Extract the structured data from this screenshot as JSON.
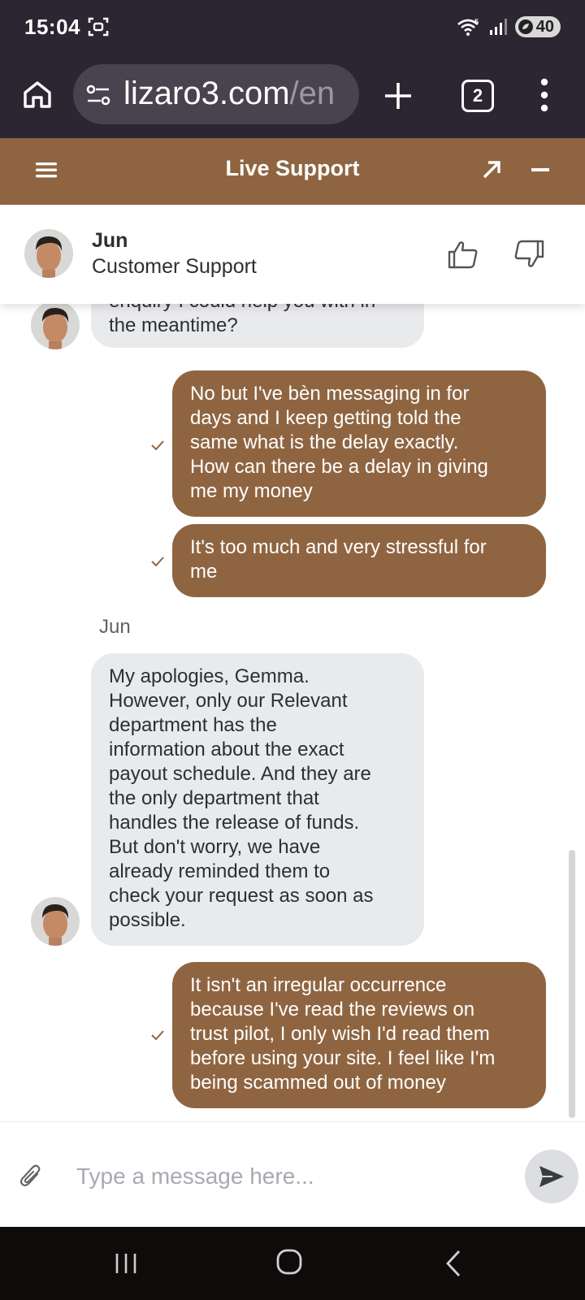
{
  "status_bar": {
    "time": "15:04",
    "battery": "40",
    "icons": [
      "screenshot-icon",
      "wifi-icon",
      "signal-icon",
      "battery-icon"
    ]
  },
  "browser": {
    "url_domain": "lizaro3.com",
    "url_path": "/en",
    "tab_count": "2",
    "icons": [
      "home-icon",
      "site-settings-icon",
      "plus-icon",
      "more-vert-icon"
    ]
  },
  "support_header": {
    "title": "Live Support",
    "icons": [
      "hamburger-icon",
      "expand-icon",
      "minimize-icon"
    ]
  },
  "agent": {
    "name": "Jun",
    "role": "Customer Support"
  },
  "messages": [
    {
      "from": "agent",
      "text": "enquiry I could help you with in\nthe meantime?"
    },
    {
      "from": "user",
      "text": "No but I've bèn messaging in for\ndays and I keep getting told the\nsame what is the delay exactly.\nHow can there be a delay in giving\nme my money"
    },
    {
      "from": "user",
      "text": "It's too much and very stressful for\nme"
    },
    {
      "from": "agent",
      "sender": "Jun",
      "text": "My apologies, Gemma.\nHowever, only our Relevant\ndepartment has the\ninformation about the exact\npayout schedule. And they are\nthe only department that\nhandles the release of funds.\nBut don't worry, we have\nalready reminded them to\ncheck your request as soon as\npossible."
    },
    {
      "from": "user",
      "text": "It isn't an irregular occurrence\nbecause I've read the reviews on\ntrust pilot, I only wish I'd read them\nbefore using your site. I feel like I'm\nbeing scammed out of money"
    }
  ],
  "composer": {
    "placeholder": "Type a message here..."
  },
  "colors": {
    "brand": "#8f6541",
    "agent_bubble": "#e9eaec",
    "browser_chrome": "#2b2632"
  }
}
